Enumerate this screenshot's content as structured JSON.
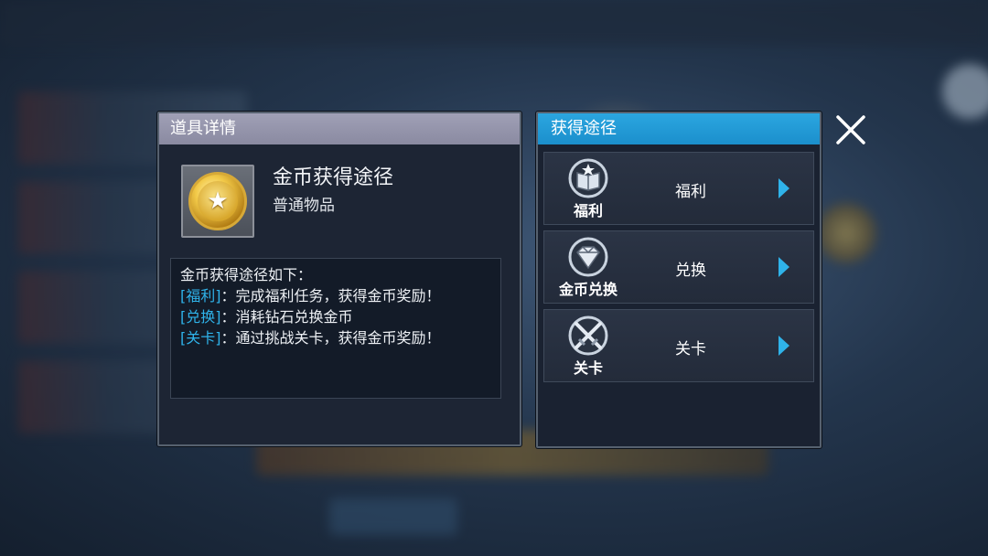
{
  "item_panel": {
    "title": "道具详情",
    "item_name": "金币获得途径",
    "item_type": "普通物品",
    "icon": "gold-coin-icon",
    "description": {
      "intro": "金币获得途径如下：",
      "lines": [
        {
          "tag": "[福利]",
          "text": "：完成福利任务，获得金币奖励！"
        },
        {
          "tag": "[兑换]",
          "text": "：消耗钻石兑换金币"
        },
        {
          "tag": "[关卡]",
          "text": "：通过挑战关卡，获得金币奖励！"
        }
      ]
    }
  },
  "routes_panel": {
    "title": "获得途径",
    "routes": [
      {
        "badge_label": "福利",
        "name": "福利",
        "icon": "welfare-book-icon"
      },
      {
        "badge_label": "金币兑换",
        "name": "兑换",
        "icon": "diamond-exchange-icon"
      },
      {
        "badge_label": "关卡",
        "name": "关卡",
        "icon": "crossed-swords-icon"
      }
    ]
  },
  "colors": {
    "accent": "#2fb3ea",
    "left_header": "#9a9ab0",
    "right_header": "#1b8fcc"
  }
}
